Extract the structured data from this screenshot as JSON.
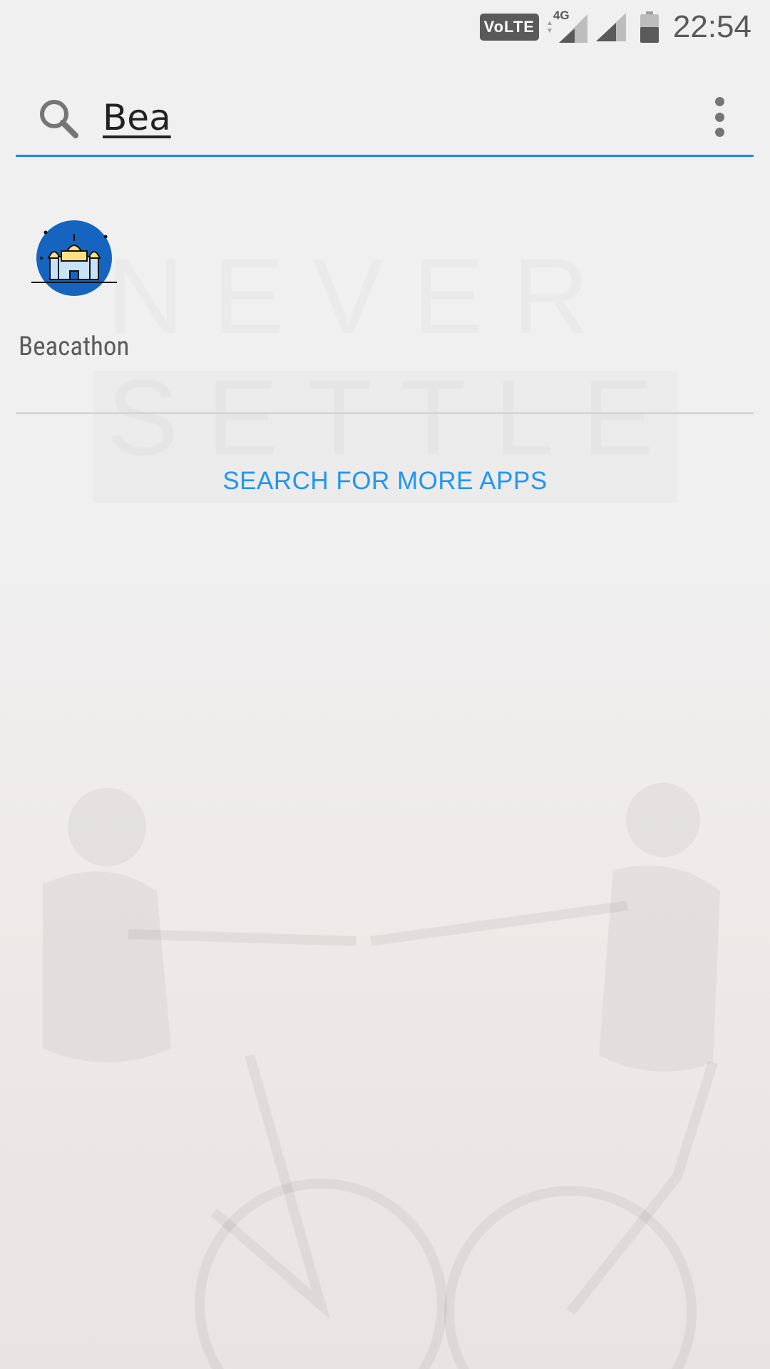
{
  "status_bar": {
    "volte": "VoLTE",
    "network": "4G",
    "time": "22:54"
  },
  "search": {
    "query": "Bea"
  },
  "results": [
    {
      "label": "Beacathon",
      "icon": "mosque-icon"
    }
  ],
  "actions": {
    "more_apps": "SEARCH FOR MORE APPS"
  },
  "colors": {
    "accent": "#2196f3",
    "underline": "#1e88e5"
  }
}
